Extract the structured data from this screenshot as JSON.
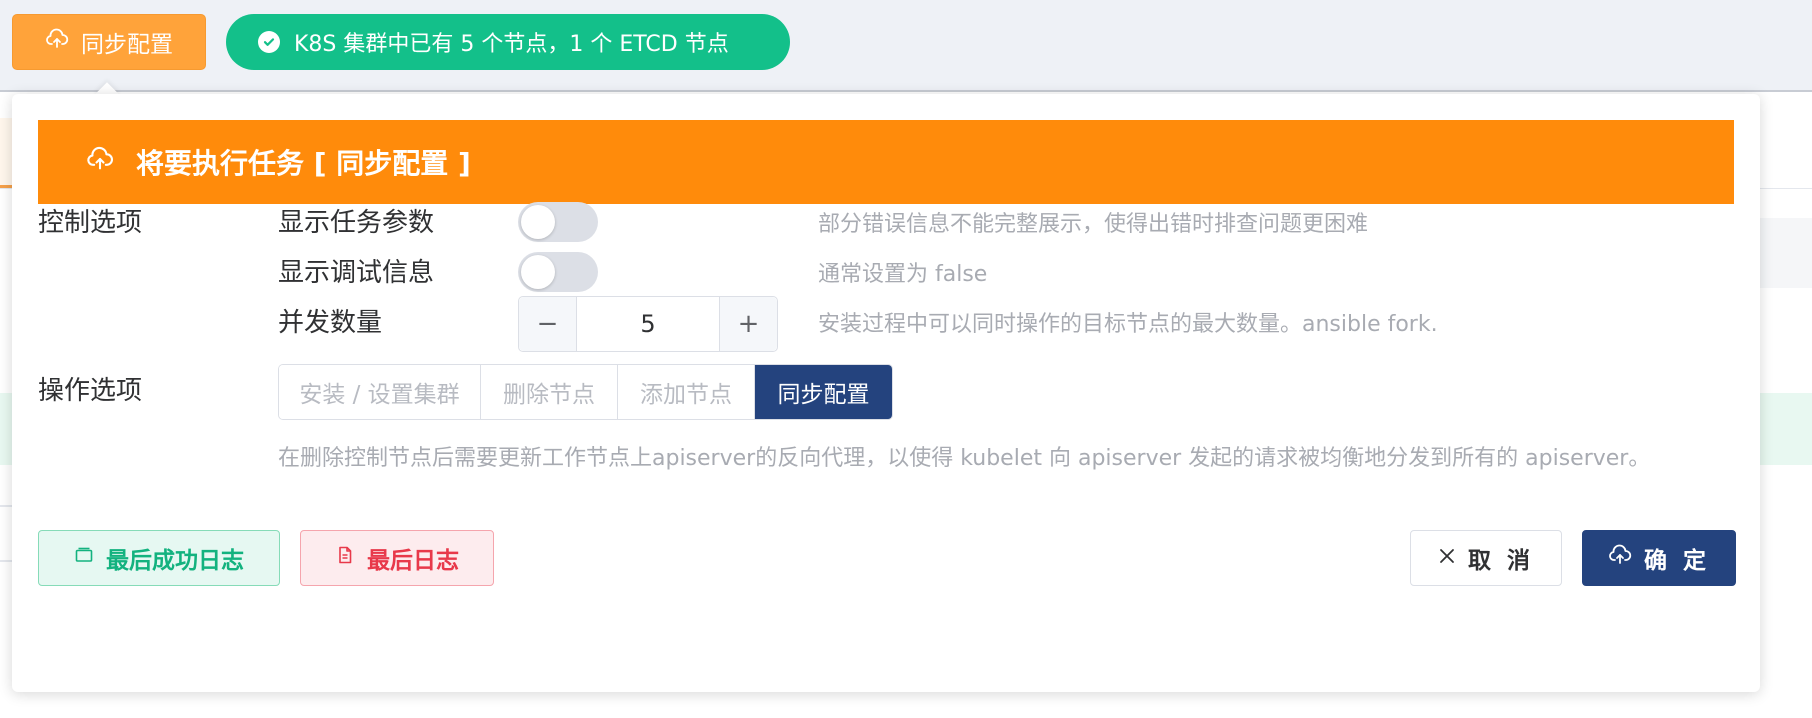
{
  "toolbar": {
    "sync_button_label": "同步配置",
    "status_text": "K8S 集群中已有 5 个节点，1 个 ETCD 节点"
  },
  "dialog": {
    "title": "将要执行任务 [ 同步配置 ]",
    "control_section_label": "控制选项",
    "options": [
      {
        "label": "显示任务参数",
        "enabled": false,
        "hint": "部分错误信息不能完整展示，使得出错时排查问题更困难"
      },
      {
        "label": "显示调试信息",
        "enabled": false,
        "hint": "通常设置为 false"
      }
    ],
    "concurrency": {
      "label": "并发数量",
      "value": "5",
      "minus": "−",
      "plus": "+",
      "hint": "安装过程中可以同时操作的目标节点的最大数量。ansible fork."
    },
    "operation_section_label": "操作选项",
    "operations": [
      {
        "label": "安装 / 设置集群",
        "active": false
      },
      {
        "label": "删除节点",
        "active": false
      },
      {
        "label": "添加节点",
        "active": false
      },
      {
        "label": "同步配置",
        "active": true
      }
    ],
    "operation_description": "在删除控制节点后需要更新工作节点上apiserver的反向代理，以使得 kubelet 向 apiserver 发起的请求被均衡地分发到所有的 apiserver。",
    "footer": {
      "success_log_label": "最后成功日志",
      "last_log_label": "最后日志",
      "cancel_label": "取 消",
      "confirm_label": "确 定"
    }
  },
  "colors": {
    "banner": "#ff8b0b",
    "primary": "#24437e",
    "success": "#13c08a",
    "danger": "#e8394a",
    "sync_button": "#ffa33a"
  }
}
